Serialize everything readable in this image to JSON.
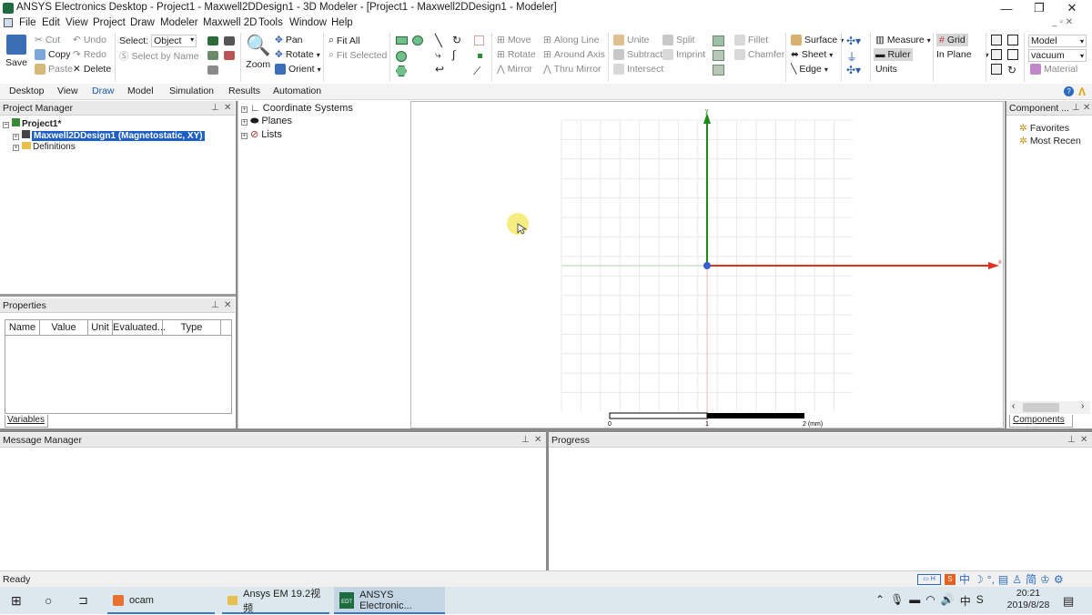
{
  "window": {
    "title": "ANSYS Electronics Desktop - Project1 - Maxwell2DDesign1 - 3D Modeler - [Project1 - Maxwell2DDesign1 - Modeler]"
  },
  "menu": [
    "File",
    "Edit",
    "View",
    "Project",
    "Draw",
    "Modeler",
    "Maxwell 2D",
    "Tools",
    "Window",
    "Help"
  ],
  "ribbon": {
    "save": "Save",
    "cut": "Cut",
    "copy": "Copy",
    "paste": "Paste",
    "undo": "Undo",
    "redo": "Redo",
    "delete": "Delete",
    "select_label": "Select:",
    "select_value": "Object",
    "select_by_name": "Select by Name",
    "zoom": "Zoom",
    "pan": "Pan",
    "rotate": "Rotate",
    "orient": "Orient",
    "fit_all": "Fit All",
    "fit_selected": "Fit Selected",
    "move": "Move",
    "rotate2": "Rotate",
    "mirror": "Mirror",
    "along_line": "Along Line",
    "around_axis": "Around Axis",
    "thru_mirror": "Thru Mirror",
    "unite": "Unite",
    "subtract": "Subtract",
    "intersect": "Intersect",
    "split": "Split",
    "imprint": "Imprint",
    "fillet": "Fillet",
    "chamfer": "Chamfer",
    "surface": "Surface",
    "sheet": "Sheet",
    "edge": "Edge",
    "measure": "Measure",
    "ruler": "Ruler",
    "units": "Units",
    "grid": "Grid",
    "in_plane": "In Plane",
    "model": "Model",
    "vacuum": "vacuum",
    "material": "Material"
  },
  "tabs": [
    "Desktop",
    "View",
    "Draw",
    "Model",
    "Simulation",
    "Results",
    "Automation"
  ],
  "project_manager": {
    "title": "Project Manager",
    "project": "Project1*",
    "design": "Maxwell2DDesign1 (Magnetostatic, XY)",
    "definitions": "Definitions"
  },
  "model_tree": [
    "Coordinate Systems",
    "Planes",
    "Lists"
  ],
  "properties": {
    "title": "Properties",
    "columns": [
      "Name",
      "Value",
      "Unit",
      "Evaluated...",
      "Type"
    ],
    "tab": "Variables"
  },
  "components": {
    "title": "Component ...",
    "items": [
      "Favorites",
      "Most Recen"
    ],
    "tab": "Components"
  },
  "viewport": {
    "scale_labels": [
      "0",
      "1",
      "2 (mm)"
    ],
    "axis_x": "x",
    "axis_y": "y"
  },
  "message_manager": "Message Manager",
  "progress": "Progress",
  "status": "Ready",
  "taskbar": {
    "items": [
      "ocam",
      "Ansys EM 19.2视频",
      "ANSYS Electronic..."
    ],
    "time": "20:21",
    "date": "2019/8/28",
    "ime": [
      "中",
      "简"
    ]
  }
}
